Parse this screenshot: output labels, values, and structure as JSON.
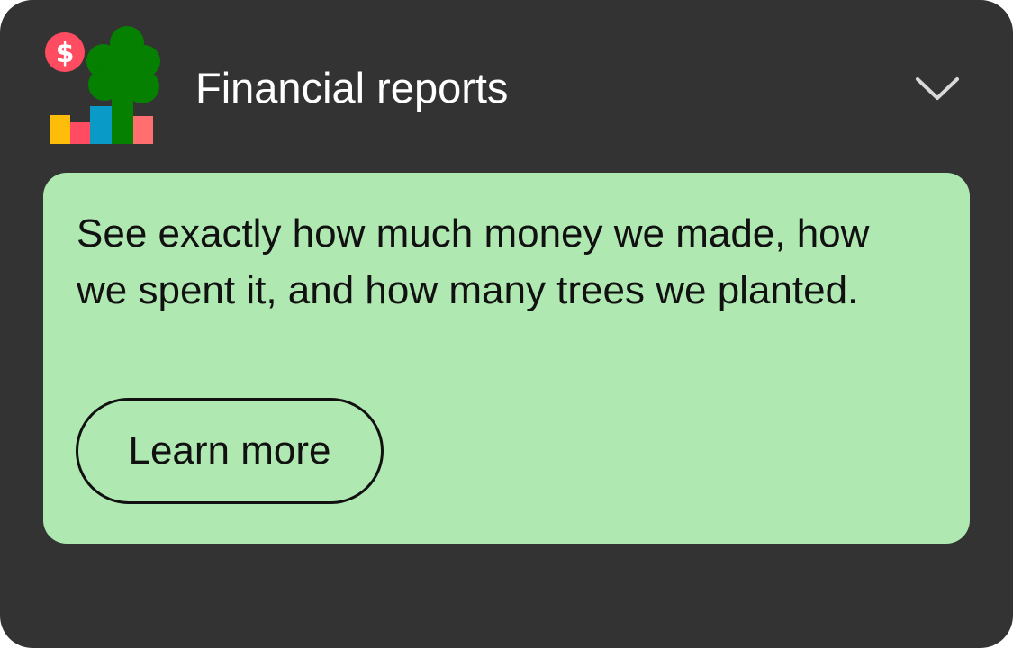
{
  "card": {
    "title": "Financial reports",
    "icon": "financial-reports-tree-chart-icon",
    "toggle_icon": "chevron-down-icon",
    "expanded": true
  },
  "panel": {
    "description": "See exactly how much money we made, how we spent it, and how many trees we planted.",
    "button_label": "Learn more"
  },
  "colors": {
    "card_background": "#333333",
    "panel_background": "#afe8b1",
    "title_text": "#ffffff",
    "panel_text": "#111111",
    "coin": "#ff4c60",
    "tree": "#058000",
    "bar_yellow": "#fdbd0a",
    "bar_pink": "#ff4c60",
    "bar_blue": "#0a9ac8",
    "bar_coral": "#ff6f6f"
  }
}
